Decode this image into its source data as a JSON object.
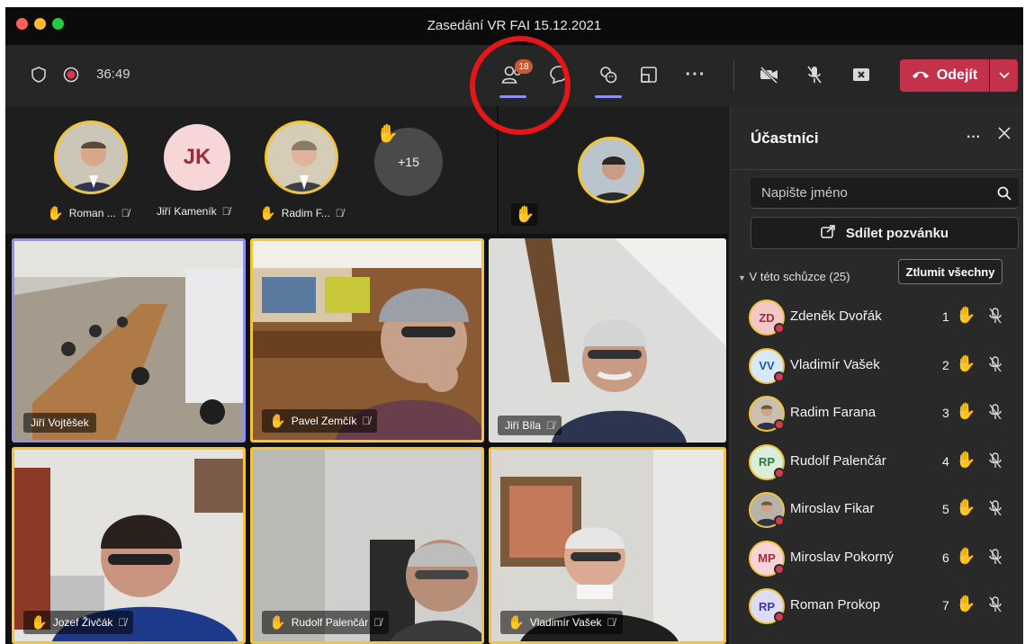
{
  "window": {
    "title": "Zasedání VR FAI 15.12.2021"
  },
  "toolbar": {
    "timer": "36:49",
    "participants_badge": "18",
    "leave_label": "Odejít"
  },
  "stage": {
    "strip": [
      {
        "name": "Roman ...",
        "hand": true
      },
      {
        "name": "Jiří Kameník",
        "initials": "JK",
        "hand": false
      },
      {
        "name": "Radim F...",
        "hand": true
      }
    ],
    "overflow_count": "+15",
    "tiles": [
      {
        "name": "Jiří Vojtěšek",
        "hand": false
      },
      {
        "name": "Pavel Zemčík",
        "hand": true
      },
      {
        "name": "Jiří Bíla",
        "hand": false
      },
      {
        "name": "Jozef Živčák",
        "hand": true
      },
      {
        "name": "Rudolf Palenčár",
        "hand": true
      },
      {
        "name": "Vladimír Vašek",
        "hand": true
      }
    ]
  },
  "panel": {
    "title": "Účastníci",
    "search_placeholder": "Napište jméno",
    "share_label": "Sdílet pozvánku",
    "section_label": "V této schůzce (25)",
    "mute_all_label": "Ztlumit všechny",
    "participants": [
      {
        "initials": "ZD",
        "name": "Zdeněk Dvořák",
        "num": "1",
        "bg": "#f4c6c6",
        "fg": "#9c2c3a"
      },
      {
        "initials": "VV",
        "name": "Vladimír Vašek",
        "num": "2",
        "bg": "#d8e8f7",
        "fg": "#1d5f9a"
      },
      {
        "initials": "",
        "name": "Radim Farana",
        "num": "3",
        "bg": "#cbbfae",
        "fg": "#333"
      },
      {
        "initials": "RP",
        "name": "Rudolf Palenčár",
        "num": "4",
        "bg": "#d9efdc",
        "fg": "#2c7a3d"
      },
      {
        "initials": "",
        "name": "Miroslav Fikar",
        "num": "5",
        "bg": "#b9b2a8",
        "fg": "#333"
      },
      {
        "initials": "MP",
        "name": "Miroslav Pokorný",
        "num": "6",
        "bg": "#f7d4d8",
        "fg": "#a02c3c"
      },
      {
        "initials": "RP",
        "name": "Roman Prokop",
        "num": "7",
        "bg": "#dcdcf4",
        "fg": "#3b3b9a"
      }
    ]
  },
  "colors": {
    "accent": "#8f8ff0",
    "leave": "#c4314b",
    "raised_hand": "#f4c025",
    "annotation": "#e31717"
  }
}
